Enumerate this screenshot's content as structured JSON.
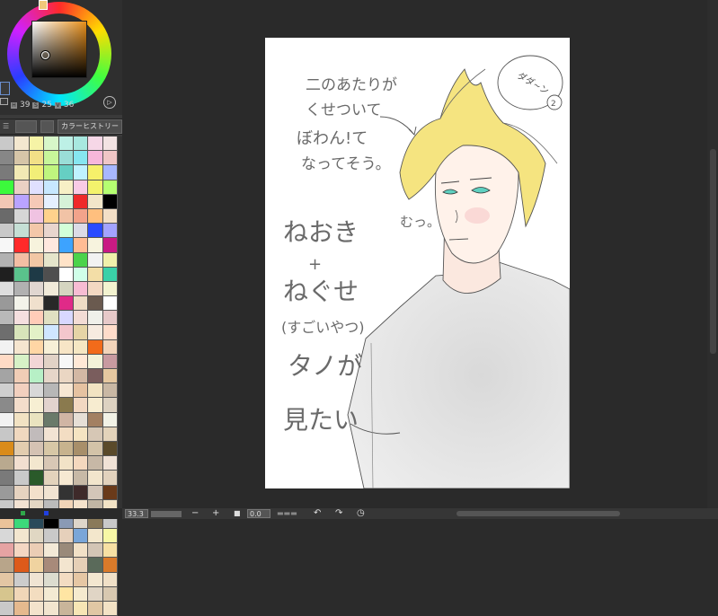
{
  "color_picker": {
    "h_tag": "H",
    "h_value": "39",
    "s_tag": "S",
    "s_value": "25",
    "v_tag": "V",
    "v_value": "36"
  },
  "palette_tabs": {
    "history_label": "カラーヒストリー"
  },
  "palette_colors": [
    "#c9c9c9",
    "#f3e7cf",
    "#f6f3a6",
    "#d7f6c9",
    "#bdf0e6",
    "#a8e8e0",
    "#f6d7e7",
    "#f2e3e3",
    "#878787",
    "#d6c5a8",
    "#f2e087",
    "#c7f69a",
    "#9aded7",
    "#86e6f0",
    "#f7b7da",
    "#f0c6c6",
    "#7a7a7a",
    "#f2e9b4",
    "#f2ee78",
    "#bff57e",
    "#66cfc3",
    "#bff2ff",
    "#f6f06a",
    "#a7b7ff",
    "#3cfa3c",
    "#ead0c3",
    "#e0e0ff",
    "#c7e7ff",
    "#f7f0c6",
    "#f9cbe5",
    "#f3f36c",
    "#b5ff71",
    "#f2c7b4",
    "#b9a3ff",
    "#f5c9b7",
    "#e5efff",
    "#d6f2d8",
    "#ef2a2a",
    "#f2e6c9",
    "#000000",
    "#6a6a6a",
    "#d6d6d6",
    "#f0c3e2",
    "#ffd28c",
    "#f1c3a6",
    "#f2a38b",
    "#ffbf7e",
    "#f3dfc6",
    "#c9c9c9",
    "#c5dfd5",
    "#f3c7a9",
    "#e8d5ce",
    "#d3ffd8",
    "#dbdbe6",
    "#2a4bff",
    "#a3a3ff",
    "#f7f7f7",
    "#ff2a2a",
    "#f7f3dd",
    "#ffe8df",
    "#3da3ff",
    "#ffbc94",
    "#f7f3de",
    "#c91a83",
    "#b2b2b2",
    "#f3bea4",
    "#f1c7a5",
    "#e5e5cb",
    "#ffe3c8",
    "#4bd34b",
    "#f2f2f2",
    "#f0f0ab",
    "#1f1f1f",
    "#5ac28c",
    "#1e3a46",
    "#4f4f4f",
    "#ffffff",
    "#d0ffe9",
    "#f3dea7",
    "#3ad0a8",
    "#dedede",
    "#b1b1b1",
    "#e0d6d0",
    "#f1ead9",
    "#d5d5c0",
    "#f7bcd3",
    "#f3d8c2",
    "#f3f3d0",
    "#999999",
    "#f3f3ea",
    "#f0e0cd",
    "#282828",
    "#e02a88",
    "#efdcc5",
    "#6a5a4f",
    "#ffffff",
    "#b9b9b9",
    "#f5dfdf",
    "#ffccb8",
    "#e0e0c2",
    "#d8d8ff",
    "#f3dcd5",
    "#f0f0ea",
    "#e7c9c9",
    "#6e6e6e",
    "#d8e4ba",
    "#e3f1c7",
    "#cfe6ff",
    "#f3c6cc",
    "#e6d4a6",
    "#f7ebe0",
    "#ffdcca",
    "#f2f2f2",
    "#f5e5cf",
    "#ffd6a5",
    "#f7f0d7",
    "#f7e5c6",
    "#f5e7c3",
    "#f26b1a",
    "#f2d4ba",
    "#ffdbc6",
    "#d7f1c7",
    "#f2d6d6",
    "#e1d2c6",
    "#f7f7f7",
    "#ffe9d7",
    "#f3f3d9",
    "#c89aa0",
    "#a4a4a4",
    "#f0cdb6",
    "#b7f0c6",
    "#e6d6c9",
    "#ead6c3",
    "#d3b8a4",
    "#7a5d5d",
    "#e6c8a0",
    "#cfcfcf",
    "#f2d0bf",
    "#d8d8d8",
    "#b7b7b7",
    "#f7e7d3",
    "#e6c2a1",
    "#f2e3c2",
    "#c9b8a4",
    "#8a8a8a",
    "#f3ddcb",
    "#f7efd3",
    "#e2d3ce",
    "#8a7a4e",
    "#f2d8c2",
    "#f7ecd0",
    "#ddd2c1",
    "#f2f2f2",
    "#f2e2c3",
    "#e9e3bf",
    "#6a7a6a",
    "#d0b5a4",
    "#e6dfd6",
    "#a38062",
    "#f2f2e6",
    "#c7c7c7",
    "#f0d8bf",
    "#c1bbbb",
    "#f2e3d3",
    "#f3ddc3",
    "#f5e4c2",
    "#d6c7b5",
    "#e3d3ba",
    "#d98b1a",
    "#e2ccaf",
    "#d4c2b3",
    "#d7c7a6",
    "#c7b38e",
    "#a88f6a",
    "#d3c3a8",
    "#5a4a2a",
    "#b9a98f",
    "#f2dfd0",
    "#f3e7cf",
    "#d8c7b5",
    "#f2e3c7",
    "#f4d8be",
    "#c7b8a6",
    "#f0e2d6",
    "#7a7a7a",
    "#c9c9c9",
    "#2a5a2a",
    "#e3d3bc",
    "#f6e9d2",
    "#c7b9a6",
    "#f2e5cc",
    "#e2d2bd",
    "#9a9a9a",
    "#e6d3c0",
    "#f3e0cb",
    "#f1e3d1",
    "#333333",
    "#3e2a2a",
    "#d3c5b8",
    "#6a3a1a",
    "#c9c9c9",
    "#f3e3d3",
    "#e3d6c3",
    "#bbbbbb",
    "#f2d5b8",
    "#f5e3cc",
    "#c1b5a4",
    "#f2e3c5",
    "#ebc39a",
    "#3cd97a",
    "#2a4a5a",
    "#000000",
    "#8a9ab5",
    "#ded6ca",
    "#8a7a5a",
    "#c9c9c9",
    "#d8d8d8",
    "#f3e6cf",
    "#e0d7c3",
    "#c9c9c9",
    "#e6d0bb",
    "#7aa6d8",
    "#f3e7cc",
    "#f7f7a5",
    "#e6a3a3",
    "#f4d7c3",
    "#ebcdb5",
    "#f3e9d7",
    "#9a8a7a",
    "#f2e1c7",
    "#d3c5b5",
    "#f7e0a3",
    "#b8a58a",
    "#dd5a1a",
    "#f0d3a0",
    "#a88a7a",
    "#f3e5cf",
    "#e6d0b7",
    "#5a6a5a",
    "#d97a2a",
    "#e3c6a4",
    "#cccccc",
    "#f0e4d3",
    "#dcdccf",
    "#f3dcc2",
    "#e6c7a4",
    "#f3e7d0",
    "#f0e0c7",
    "#d6c58e",
    "#f0d6b8",
    "#f3ddc0",
    "#f3ead3",
    "#ffe5a3",
    "#f5eacf",
    "#e0d5c5",
    "#d8c8b0",
    "#c9c9c9",
    "#e5b98e",
    "#f3e3cc",
    "#f2e5cf",
    "#c9b59a",
    "#f7e6b5",
    "#e0c7a4",
    "#f3e2c5"
  ],
  "status_bar": {
    "zoom_value": "33.3",
    "zoom_out": "−",
    "zoom_in": "+",
    "angle_value": "0.0"
  },
  "canvas": {
    "note_1": "二のあたりが",
    "note_2": "くせついて",
    "note_3": "ぼわん!て",
    "note_4": "なってそう。",
    "note_5": "ねおき",
    "note_6": "+",
    "note_7": "ねぐせ",
    "note_8": "(すごいやつ)",
    "note_9": "タノが",
    "note_10": "見たい",
    "note_11": "むっ。",
    "bubble_text": "ダダ~ン",
    "bubble_num": "2"
  }
}
